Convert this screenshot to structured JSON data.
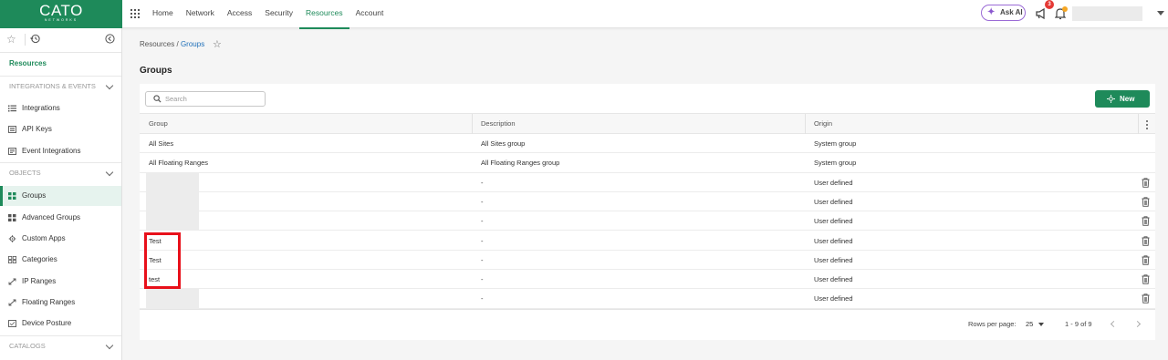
{
  "app": {
    "logo": "CATO",
    "logo_sub": "NETWORKS"
  },
  "nav": [
    "Home",
    "Network",
    "Access",
    "Security",
    "Resources",
    "Account"
  ],
  "nav_active": "Resources",
  "header": {
    "ask_ai": "Ask AI",
    "notification_count": "3"
  },
  "sidebar": {
    "title": "Resources",
    "sections": {
      "integrations": "INTEGRATIONS & EVENTS",
      "objects": "OBJECTS",
      "catalogs": "CATALOGS"
    },
    "integrations_items": [
      {
        "label": "Integrations",
        "icon": "list-icon"
      },
      {
        "label": "API Keys",
        "icon": "key-list-icon"
      },
      {
        "label": "Event Integrations",
        "icon": "event-icon"
      }
    ],
    "objects_items": [
      {
        "label": "Groups",
        "icon": "grid-icon",
        "active": true
      },
      {
        "label": "Advanced Groups",
        "icon": "grid-icon"
      },
      {
        "label": "Custom Apps",
        "icon": "gear-icon"
      },
      {
        "label": "Categories",
        "icon": "categories-icon"
      },
      {
        "label": "IP Ranges",
        "icon": "arrows-icon"
      },
      {
        "label": "Floating Ranges",
        "icon": "arrows-icon"
      },
      {
        "label": "Device Posture",
        "icon": "device-icon"
      }
    ]
  },
  "breadcrumb": {
    "parent": "Resources",
    "separator": "/",
    "current": "Groups"
  },
  "page_title": "Groups",
  "toolbar": {
    "search_placeholder": "Search",
    "new_label": "New"
  },
  "table": {
    "columns": [
      "Group",
      "Description",
      "Origin"
    ],
    "rows": [
      {
        "group": "All Sites",
        "description": "All Sites group",
        "origin": "System group",
        "deletable": false,
        "redacted": false
      },
      {
        "group": "All Floating Ranges",
        "description": "All Floating Ranges group",
        "origin": "System group",
        "deletable": false,
        "redacted": false
      },
      {
        "group": "",
        "description": "-",
        "origin": "User defined",
        "deletable": true,
        "redacted": true
      },
      {
        "group": "",
        "description": "-",
        "origin": "User defined",
        "deletable": true,
        "redacted": true
      },
      {
        "group": "",
        "description": "-",
        "origin": "User defined",
        "deletable": true,
        "redacted": true
      },
      {
        "group": "Test",
        "description": "-",
        "origin": "User defined",
        "deletable": true,
        "redacted": false
      },
      {
        "group": "Test",
        "description": "-",
        "origin": "User defined",
        "deletable": true,
        "redacted": false
      },
      {
        "group": "test",
        "description": "-",
        "origin": "User defined",
        "deletable": true,
        "redacted": false
      },
      {
        "group": "",
        "description": "-",
        "origin": "User defined",
        "deletable": true,
        "redacted": true
      }
    ]
  },
  "pagination": {
    "rows_per_page_label": "Rows per page:",
    "rows_per_page": "25",
    "range": "1 - 9 of 9"
  },
  "colors": {
    "brand": "#1e8a5a",
    "link": "#1e6fb8",
    "highlight": "#e8101a",
    "ai_border": "#9b6bd6"
  }
}
